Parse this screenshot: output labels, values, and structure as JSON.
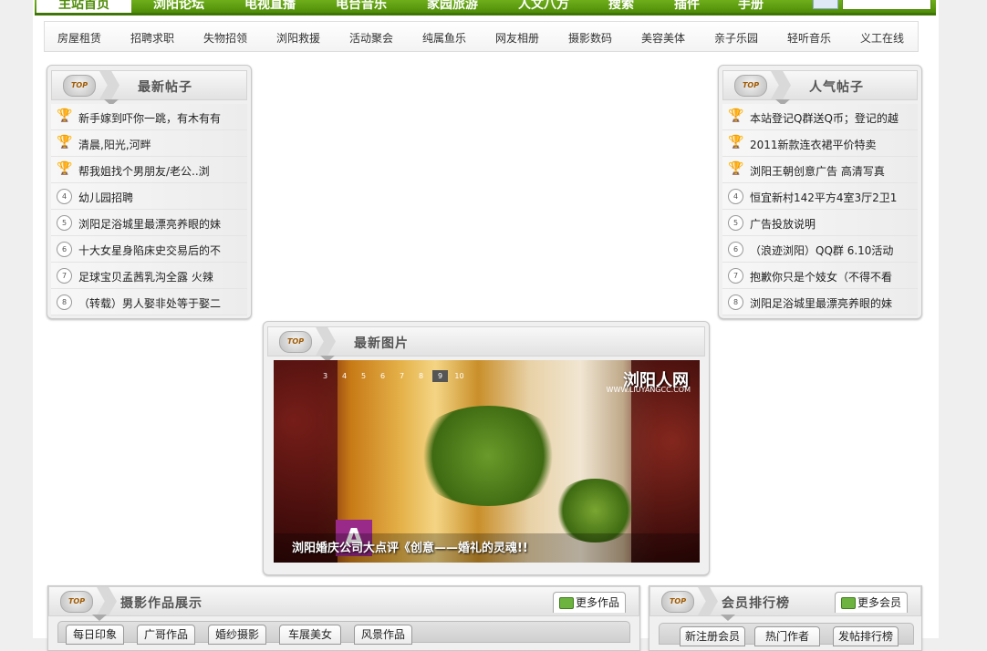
{
  "main_nav": {
    "items": [
      "主站首页",
      "浏阳论坛",
      "电视直播",
      "电台音乐",
      "家园旅游",
      "人文八方",
      "搜索",
      "插件",
      "手册"
    ],
    "active_index": 0
  },
  "sub_nav": {
    "items": [
      "房屋租赁",
      "招聘求职",
      "失物招领",
      "浏阳救援",
      "活动聚会",
      "纯属鱼乐",
      "网友相册",
      "摄影数码",
      "美容美体",
      "亲子乐园",
      "轻听音乐",
      "义工在线"
    ]
  },
  "latest_posts": {
    "badge": "TOP",
    "title": "最新帖子",
    "items": [
      "新手嫁到吓你一跳，有木有有",
      "清晨,阳光,河畔",
      "帮我姐找个男朋友/老公..浏",
      "幼儿园招聘",
      "浏阳足浴城里最漂亮养眼的妹",
      "十大女星身陷床史交易后的不",
      "足球宝贝孟茜乳沟全露 火辣",
      "（转载）男人娶非处等于娶二"
    ],
    "ranks": [
      "1",
      "2",
      "3",
      "4",
      "5",
      "6",
      "7",
      "8"
    ]
  },
  "hot_posts": {
    "badge": "TOP",
    "title": "人气帖子",
    "items": [
      "本站登记Q群送Q币；登记的越",
      "2011新款连衣裙平价特卖",
      "浏阳王朝创意广告 高清写真",
      "恒宜新村142平方4室3厅2卫1",
      "广告投放说明",
      "（浪迹浏阳）QQ群 6.10活动",
      "抱歉你只是个妓女（不得不看",
      "浏阳足浴城里最漂亮养眼的妹"
    ],
    "ranks": [
      "1",
      "2",
      "3",
      "4",
      "5",
      "6",
      "7",
      "8"
    ]
  },
  "latest_pics": {
    "badge": "TOP",
    "title": "最新图片",
    "pager": [
      "3",
      "4",
      "5",
      "6",
      "7",
      "8",
      "9",
      "10"
    ],
    "active_page": "9",
    "site_title": "浏阳人网",
    "site_url": "WWW.LIUYANGCC.COM",
    "caption": "浏阳婚庆公司大点评《创意——婚礼的灵魂!!"
  },
  "photo_showcase": {
    "badge": "TOP",
    "title": "摄影作品展示",
    "more_label": "更多作品",
    "tabs": [
      "每日印象",
      "广哥作品",
      "婚纱摄影",
      "车展美女",
      "风景作品"
    ]
  },
  "member_rank": {
    "badge": "TOP",
    "title": "会员排行榜",
    "more_label": "更多会员",
    "tabs": [
      "新注册会员",
      "热门作者",
      "发帖排行榜"
    ]
  },
  "colors": {
    "nav_green": "#4f8c08",
    "trophy_gold": "#d4a017"
  }
}
